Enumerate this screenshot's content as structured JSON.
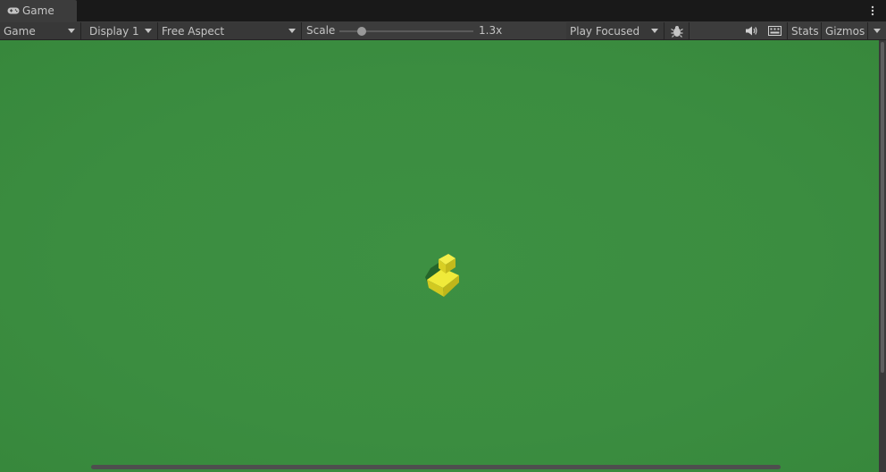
{
  "tab": {
    "label": "Game",
    "icon": "gamepad-icon"
  },
  "tab_menu_icon": "kebab-menu-icon",
  "toolbar": {
    "view_mode": "Game",
    "display": "Display 1",
    "aspect": "Free Aspect",
    "scale_label": "Scale",
    "scale_value": "1.3x",
    "play_mode": "Play Focused",
    "stats_label": "Stats",
    "gizmos_label": "Gizmos",
    "icons": [
      "bug-icon",
      "speaker-icon",
      "keyboard-icon"
    ]
  },
  "viewport": {
    "background_color": "#3b8d40",
    "object_color": "#e2dc2e"
  }
}
